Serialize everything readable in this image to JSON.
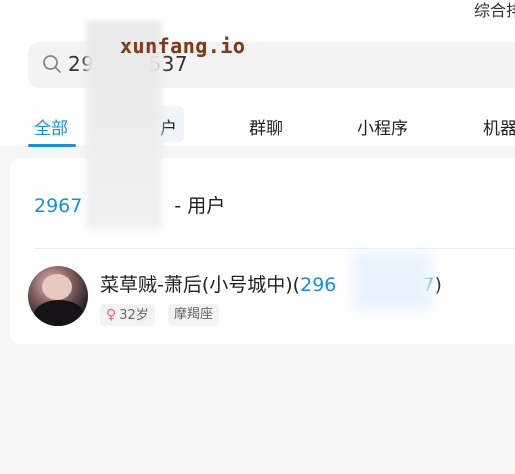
{
  "header": {
    "top_right_text": "综合排"
  },
  "search": {
    "value_prefix": "29",
    "value_suffix": "537"
  },
  "watermark": {
    "text": "xunfang.io"
  },
  "tabs": [
    {
      "label": "全部",
      "active": true
    },
    {
      "label": "户"
    },
    {
      "label": "群聊"
    },
    {
      "label": "小程序"
    },
    {
      "label": "机器"
    }
  ],
  "section": {
    "number_prefix": "2967",
    "title_suffix": "- 用户"
  },
  "result": {
    "name_text": "菜草贼-萧后(小号城中)(",
    "number_prefix": "296",
    "number_suffix": "7",
    "close_paren": ")",
    "age": "32岁",
    "zodiac": "摩羯座"
  },
  "colors": {
    "accent": "#1a8fd1",
    "female": "#e0609a"
  },
  "icons": {
    "search": "search-icon",
    "gender": "female-icon"
  }
}
